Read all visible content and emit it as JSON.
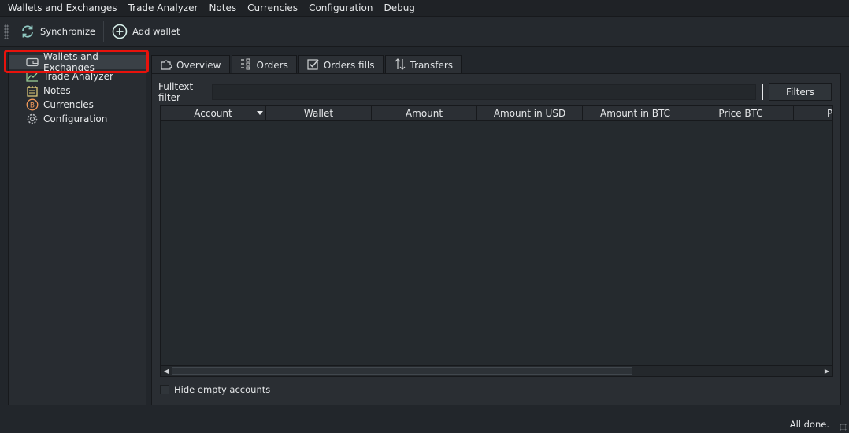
{
  "menubar": {
    "items": [
      {
        "label": "Wallets and Exchanges"
      },
      {
        "label": "Trade Analyzer"
      },
      {
        "label": "Notes"
      },
      {
        "label": "Currencies"
      },
      {
        "label": "Configuration"
      },
      {
        "label": "Debug"
      }
    ]
  },
  "toolbar": {
    "synchronize_label": "Synchronize",
    "synchronize_icon": "sync-icon",
    "add_wallet_label": "Add wallet",
    "add_wallet_icon": "plus-circle-icon"
  },
  "sidebar": {
    "items": [
      {
        "label": "Wallets and Exchanges",
        "icon": "wallet-icon",
        "selected": true
      },
      {
        "label": "Trade Analyzer",
        "icon": "chart-icon"
      },
      {
        "label": "Notes",
        "icon": "notes-icon"
      },
      {
        "label": "Currencies",
        "icon": "bitcoin-icon"
      },
      {
        "label": "Configuration",
        "icon": "gear-icon"
      }
    ]
  },
  "tabs": [
    {
      "label": "Overview",
      "icon": "puzzle-icon",
      "active": true
    },
    {
      "label": "Orders",
      "icon": "list-icon"
    },
    {
      "label": "Orders fills",
      "icon": "checkbox-icon"
    },
    {
      "label": "Transfers",
      "icon": "transfer-icon"
    }
  ],
  "filter": {
    "label": "Fulltext filter",
    "value": "",
    "button_label": "Filters"
  },
  "table": {
    "columns": [
      "Account",
      "Wallet",
      "Amount",
      "Amount in USD",
      "Amount in BTC",
      "Price BTC",
      "Pr"
    ],
    "sort_column": "Account",
    "rows": []
  },
  "options": {
    "hide_empty_label": "Hide empty accounts",
    "hide_empty_checked": false
  },
  "status": {
    "text": "All done."
  },
  "colors": {
    "highlight": "#e8120c",
    "background": "#22262b",
    "text": "#e6e8ea"
  }
}
